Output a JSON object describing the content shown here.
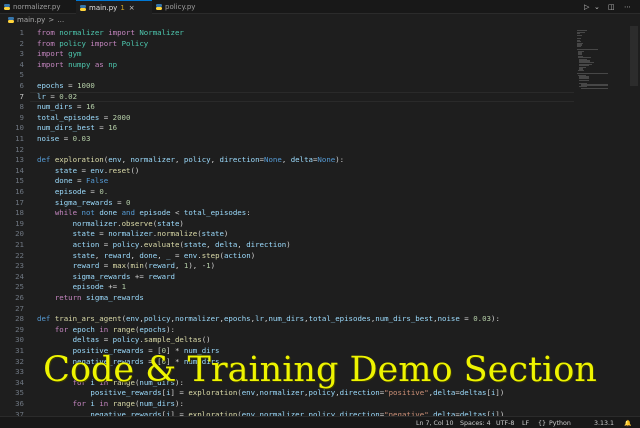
{
  "tabs": [
    {
      "label": "normalizer.py",
      "modified": "",
      "close": ""
    },
    {
      "label": "main.py",
      "modified": "1",
      "close": "×"
    },
    {
      "label": "policy.py",
      "modified": "",
      "close": ""
    }
  ],
  "tab_controls": {
    "run": "▷",
    "chevron": "⌄",
    "split": "◫",
    "more": "⋯"
  },
  "breadcrumb": {
    "file": "main.py",
    "sep": ">",
    "rest": "…"
  },
  "editor": {
    "current_line": 7,
    "lines": [
      {
        "n": "1",
        "t": [
          [
            "k",
            "from "
          ],
          [
            "c",
            "normalizer "
          ],
          [
            "k",
            "import "
          ],
          [
            "c",
            "Normalizer"
          ]
        ]
      },
      {
        "n": "2",
        "t": [
          [
            "k",
            "from "
          ],
          [
            "c",
            "policy "
          ],
          [
            "k",
            "import "
          ],
          [
            "c",
            "Policy"
          ]
        ]
      },
      {
        "n": "3",
        "t": [
          [
            "k",
            "import "
          ],
          [
            "c",
            "gym"
          ]
        ]
      },
      {
        "n": "4",
        "t": [
          [
            "k",
            "import "
          ],
          [
            "c",
            "numpy "
          ],
          [
            "k",
            "as "
          ],
          [
            "c",
            "np"
          ]
        ]
      },
      {
        "n": "5",
        "t": []
      },
      {
        "n": "6",
        "t": [
          [
            "v",
            "epochs"
          ],
          [
            "o",
            " = "
          ],
          [
            "n",
            "1000"
          ]
        ]
      },
      {
        "n": "7",
        "t": [
          [
            "v",
            "lr"
          ],
          [
            "o",
            " = "
          ],
          [
            "n",
            "0.02"
          ]
        ]
      },
      {
        "n": "8",
        "t": [
          [
            "v",
            "num_dirs"
          ],
          [
            "o",
            " = "
          ],
          [
            "n",
            "16"
          ]
        ]
      },
      {
        "n": "9",
        "t": [
          [
            "v",
            "total_episodes"
          ],
          [
            "o",
            " = "
          ],
          [
            "n",
            "2000"
          ]
        ]
      },
      {
        "n": "10",
        "t": [
          [
            "v",
            "num_dirs_best"
          ],
          [
            "o",
            " = "
          ],
          [
            "n",
            "16"
          ]
        ]
      },
      {
        "n": "11",
        "t": [
          [
            "v",
            "noise"
          ],
          [
            "o",
            " = "
          ],
          [
            "n",
            "0.03"
          ]
        ]
      },
      {
        "n": "12",
        "t": []
      },
      {
        "n": "13",
        "t": [
          [
            "d",
            "def "
          ],
          [
            "f",
            "exploration"
          ],
          [
            "o",
            "("
          ],
          [
            "v",
            "env"
          ],
          [
            "o",
            ", "
          ],
          [
            "v",
            "normalizer"
          ],
          [
            "o",
            ", "
          ],
          [
            "v",
            "policy"
          ],
          [
            "o",
            ", "
          ],
          [
            "v",
            "direction"
          ],
          [
            "o",
            "="
          ],
          [
            "d",
            "None"
          ],
          [
            "o",
            ", "
          ],
          [
            "v",
            "delta"
          ],
          [
            "o",
            "="
          ],
          [
            "d",
            "None"
          ],
          [
            "o",
            "):"
          ]
        ]
      },
      {
        "n": "14",
        "t": [
          [
            "o",
            "    "
          ],
          [
            "v",
            "state"
          ],
          [
            "o",
            " = "
          ],
          [
            "v",
            "env"
          ],
          [
            "o",
            "."
          ],
          [
            "f",
            "reset"
          ],
          [
            "o",
            "()"
          ]
        ]
      },
      {
        "n": "15",
        "t": [
          [
            "o",
            "    "
          ],
          [
            "v",
            "done"
          ],
          [
            "o",
            " = "
          ],
          [
            "d",
            "False"
          ]
        ]
      },
      {
        "n": "16",
        "t": [
          [
            "o",
            "    "
          ],
          [
            "v",
            "episode"
          ],
          [
            "o",
            " = "
          ],
          [
            "n",
            "0."
          ]
        ]
      },
      {
        "n": "17",
        "t": [
          [
            "o",
            "    "
          ],
          [
            "v",
            "sigma_rewards"
          ],
          [
            "o",
            " = "
          ],
          [
            "n",
            "0"
          ]
        ]
      },
      {
        "n": "18",
        "t": [
          [
            "o",
            "    "
          ],
          [
            "k",
            "while "
          ],
          [
            "d",
            "not "
          ],
          [
            "v",
            "done "
          ],
          [
            "d",
            "and "
          ],
          [
            "v",
            "episode"
          ],
          [
            "o",
            " < "
          ],
          [
            "v",
            "total_episodes"
          ],
          [
            "o",
            ":"
          ]
        ]
      },
      {
        "n": "19",
        "t": [
          [
            "o",
            "        "
          ],
          [
            "v",
            "normalizer"
          ],
          [
            "o",
            "."
          ],
          [
            "f",
            "observe"
          ],
          [
            "o",
            "("
          ],
          [
            "v",
            "state"
          ],
          [
            "o",
            ")"
          ]
        ]
      },
      {
        "n": "20",
        "t": [
          [
            "o",
            "        "
          ],
          [
            "v",
            "state"
          ],
          [
            "o",
            " = "
          ],
          [
            "v",
            "normalizer"
          ],
          [
            "o",
            "."
          ],
          [
            "f",
            "normalize"
          ],
          [
            "o",
            "("
          ],
          [
            "v",
            "state"
          ],
          [
            "o",
            ")"
          ]
        ]
      },
      {
        "n": "21",
        "t": [
          [
            "o",
            "        "
          ],
          [
            "v",
            "action"
          ],
          [
            "o",
            " = "
          ],
          [
            "v",
            "policy"
          ],
          [
            "o",
            "."
          ],
          [
            "f",
            "evaluate"
          ],
          [
            "o",
            "("
          ],
          [
            "v",
            "state"
          ],
          [
            "o",
            ", "
          ],
          [
            "v",
            "delta"
          ],
          [
            "o",
            ", "
          ],
          [
            "v",
            "direction"
          ],
          [
            "o",
            ")"
          ]
        ]
      },
      {
        "n": "22",
        "t": [
          [
            "o",
            "        "
          ],
          [
            "v",
            "state"
          ],
          [
            "o",
            ", "
          ],
          [
            "v",
            "reward"
          ],
          [
            "o",
            ", "
          ],
          [
            "v",
            "done"
          ],
          [
            "o",
            ", "
          ],
          [
            "v",
            "_"
          ],
          [
            "o",
            " = "
          ],
          [
            "v",
            "env"
          ],
          [
            "o",
            "."
          ],
          [
            "f",
            "step"
          ],
          [
            "o",
            "("
          ],
          [
            "v",
            "action"
          ],
          [
            "o",
            ")"
          ]
        ]
      },
      {
        "n": "23",
        "t": [
          [
            "o",
            "        "
          ],
          [
            "v",
            "reward"
          ],
          [
            "o",
            " = "
          ],
          [
            "f",
            "max"
          ],
          [
            "o",
            "("
          ],
          [
            "f",
            "min"
          ],
          [
            "o",
            "("
          ],
          [
            "v",
            "reward"
          ],
          [
            "o",
            ", "
          ],
          [
            "n",
            "1"
          ],
          [
            "o",
            "), -"
          ],
          [
            "n",
            "1"
          ],
          [
            "o",
            ")"
          ]
        ]
      },
      {
        "n": "24",
        "t": [
          [
            "o",
            "        "
          ],
          [
            "v",
            "sigma_rewards"
          ],
          [
            "o",
            " += "
          ],
          [
            "v",
            "reward"
          ]
        ]
      },
      {
        "n": "25",
        "t": [
          [
            "o",
            "        "
          ],
          [
            "v",
            "episode"
          ],
          [
            "o",
            " += "
          ],
          [
            "n",
            "1"
          ]
        ]
      },
      {
        "n": "26",
        "t": [
          [
            "o",
            "    "
          ],
          [
            "k",
            "return "
          ],
          [
            "v",
            "sigma_rewards"
          ]
        ]
      },
      {
        "n": "27",
        "t": []
      },
      {
        "n": "28",
        "t": [
          [
            "d",
            "def "
          ],
          [
            "f",
            "train_ars_agent"
          ],
          [
            "o",
            "("
          ],
          [
            "v",
            "env"
          ],
          [
            "o",
            ","
          ],
          [
            "v",
            "policy"
          ],
          [
            "o",
            ","
          ],
          [
            "v",
            "normalizer"
          ],
          [
            "o",
            ","
          ],
          [
            "v",
            "epochs"
          ],
          [
            "o",
            ","
          ],
          [
            "v",
            "lr"
          ],
          [
            "o",
            ","
          ],
          [
            "v",
            "num_dirs"
          ],
          [
            "o",
            ","
          ],
          [
            "v",
            "total_episodes"
          ],
          [
            "o",
            ","
          ],
          [
            "v",
            "num_dirs_best"
          ],
          [
            "o",
            ","
          ],
          [
            "v",
            "noise"
          ],
          [
            "o",
            " = "
          ],
          [
            "n",
            "0.03"
          ],
          [
            "o",
            "):"
          ]
        ]
      },
      {
        "n": "29",
        "t": [
          [
            "o",
            "    "
          ],
          [
            "k",
            "for "
          ],
          [
            "v",
            "epoch "
          ],
          [
            "k",
            "in "
          ],
          [
            "f",
            "range"
          ],
          [
            "o",
            "("
          ],
          [
            "v",
            "epochs"
          ],
          [
            "o",
            "):"
          ]
        ]
      },
      {
        "n": "30",
        "t": [
          [
            "o",
            "        "
          ],
          [
            "v",
            "deltas"
          ],
          [
            "o",
            " = "
          ],
          [
            "v",
            "policy"
          ],
          [
            "o",
            "."
          ],
          [
            "f",
            "sample_deltas"
          ],
          [
            "o",
            "()"
          ]
        ]
      },
      {
        "n": "31",
        "t": [
          [
            "o",
            "        "
          ],
          [
            "v",
            "positive_rewards"
          ],
          [
            "o",
            " = ["
          ],
          [
            "n",
            "0"
          ],
          [
            "o",
            "] * "
          ],
          [
            "v",
            "num_dirs"
          ]
        ]
      },
      {
        "n": "32",
        "t": [
          [
            "o",
            "        "
          ],
          [
            "v",
            "negative_rewards"
          ],
          [
            "o",
            " = ["
          ],
          [
            "n",
            "0"
          ],
          [
            "o",
            "] * "
          ],
          [
            "v",
            "num_dirs"
          ]
        ]
      },
      {
        "n": "33",
        "t": []
      },
      {
        "n": "34",
        "t": [
          [
            "o",
            "        "
          ],
          [
            "k",
            "for "
          ],
          [
            "v",
            "i "
          ],
          [
            "k",
            "in "
          ],
          [
            "f",
            "range"
          ],
          [
            "o",
            "("
          ],
          [
            "v",
            "num_dirs"
          ],
          [
            "o",
            "):"
          ]
        ]
      },
      {
        "n": "35",
        "t": [
          [
            "o",
            "            "
          ],
          [
            "v",
            "positive_rewards"
          ],
          [
            "o",
            "["
          ],
          [
            "v",
            "i"
          ],
          [
            "o",
            "] = "
          ],
          [
            "f",
            "exploration"
          ],
          [
            "o",
            "("
          ],
          [
            "v",
            "env"
          ],
          [
            "o",
            ","
          ],
          [
            "v",
            "normalizer"
          ],
          [
            "o",
            ","
          ],
          [
            "v",
            "policy"
          ],
          [
            "o",
            ","
          ],
          [
            "v",
            "direction"
          ],
          [
            "o",
            "="
          ],
          [
            "s",
            "\"positive\""
          ],
          [
            "o",
            ","
          ],
          [
            "v",
            "delta"
          ],
          [
            "o",
            "="
          ],
          [
            "v",
            "deltas"
          ],
          [
            "o",
            "["
          ],
          [
            "v",
            "i"
          ],
          [
            "o",
            "])"
          ]
        ]
      },
      {
        "n": "36",
        "t": [
          [
            "o",
            "        "
          ],
          [
            "k",
            "for "
          ],
          [
            "v",
            "i "
          ],
          [
            "k",
            "in "
          ],
          [
            "f",
            "range"
          ],
          [
            "o",
            "("
          ],
          [
            "v",
            "num_dirs"
          ],
          [
            "o",
            "):"
          ]
        ]
      },
      {
        "n": "37",
        "t": [
          [
            "o",
            "            "
          ],
          [
            "v",
            "negative_rewards"
          ],
          [
            "o",
            "["
          ],
          [
            "v",
            "i"
          ],
          [
            "o",
            "] = "
          ],
          [
            "f",
            "exploration"
          ],
          [
            "o",
            "("
          ],
          [
            "v",
            "env"
          ],
          [
            "o",
            ","
          ],
          [
            "v",
            "normalizer"
          ],
          [
            "o",
            ","
          ],
          [
            "v",
            "policy"
          ],
          [
            "o",
            ","
          ],
          [
            "v",
            "direction"
          ],
          [
            "o",
            "="
          ],
          [
            "s",
            "\"negative\""
          ],
          [
            "o",
            ","
          ],
          [
            "v",
            "delta"
          ],
          [
            "o",
            "="
          ],
          [
            "v",
            "deltas"
          ],
          [
            "o",
            "["
          ],
          [
            "v",
            "i"
          ],
          [
            "o",
            "])"
          ]
        ]
      }
    ]
  },
  "status_bar": {
    "position": "Ln 7, Col 10",
    "spaces": "Spaces: 4",
    "encoding": "UTF-8",
    "eol": "LF",
    "language_icon": "{}",
    "language": "Python",
    "version": "3.13.1",
    "bell": "🔔"
  },
  "overlay": {
    "title": "Code & Training Demo Section"
  },
  "colors": {
    "keyword": "#c586c0",
    "def": "#569cd6",
    "function": "#dcdcaa",
    "variable": "#9cdcfe",
    "number": "#b5cea8",
    "string": "#ce9178",
    "module": "#4ec9b0",
    "overlay": "#eef400",
    "accent": "#0078d4"
  }
}
